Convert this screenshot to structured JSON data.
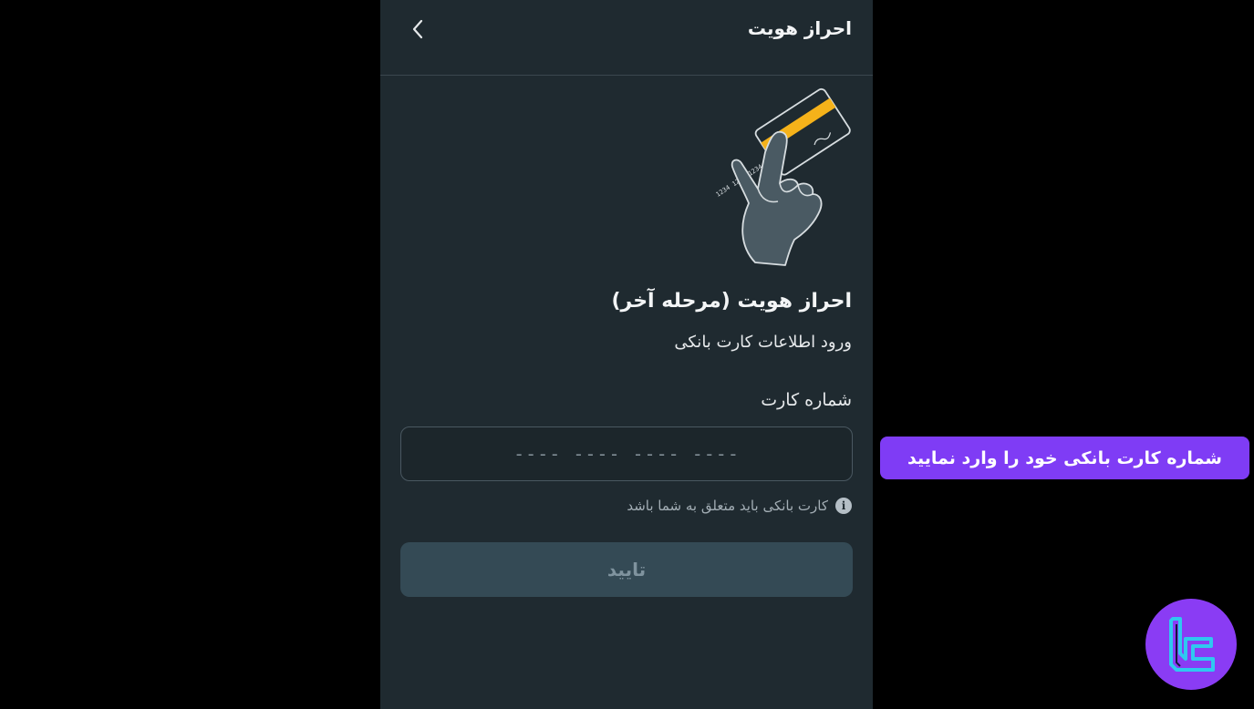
{
  "header": {
    "title": "احراز هویت",
    "back_icon": "chevron-left-icon"
  },
  "illustration": {
    "icon": "hand-holding-bank-card-icon",
    "card_number_text": "1234 1234 1234 1234",
    "accent_color": "#f5b21a"
  },
  "main": {
    "title": "احراز هویت (مرحله آخر)",
    "subtitle": "ورود اطلاعات کارت بانکی"
  },
  "form": {
    "card_label": "شماره کارت",
    "card_value": "",
    "card_placeholder": "---- ---- ---- ----",
    "hint_icon": "info-icon",
    "hint_text": "کارت بانکی باید متعلق به شما باشد",
    "submit_label": "تایید"
  },
  "overlay": {
    "callout_text": "شماره کارت بانکی خود را وارد نمایید",
    "callout_color": "#7f3cf5",
    "logo_icon": "tc-brand-logo-icon",
    "logo_color": "#8a3cf4",
    "logo_accent": "#2fc8f0"
  },
  "colors": {
    "phone_background": "#1f2a30",
    "outer_background": "#000000",
    "button_background": "#344a55"
  }
}
